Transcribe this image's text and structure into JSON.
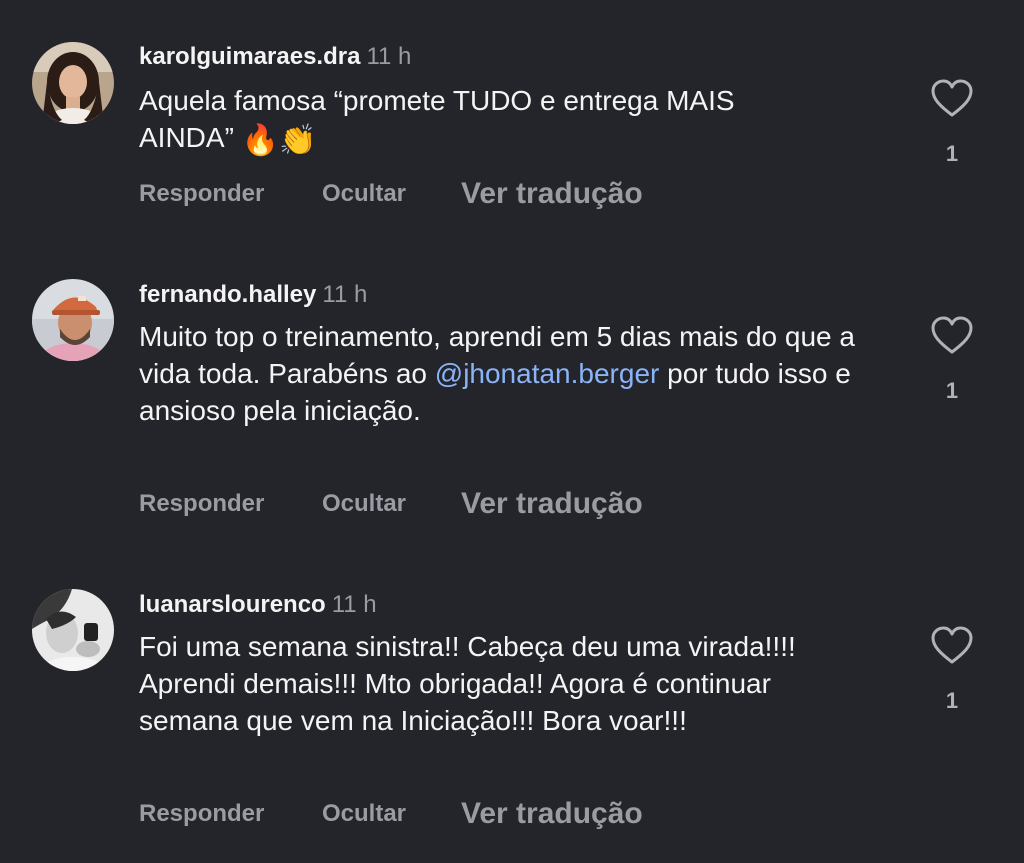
{
  "comments": [
    {
      "username": "karolguimaraes.dra",
      "time": "11 h",
      "text_line1": "Aquela famosa “promete TUDO e entrega MAIS",
      "text_line2": "AINDA”",
      "emojis": "🔥👏",
      "like_count": "1",
      "reply_label": "Responder",
      "hide_label": "Ocultar",
      "translate_label": "Ver tradução",
      "avatar_icon": "profile-photo-woman"
    },
    {
      "username": "fernando.halley",
      "time": "11 h",
      "text_before_mention": "Muito top o treinamento, aprendi em 5 dias mais do que a vida toda. Parabéns ao",
      "mention": "@jhonatan.berger",
      "text_after_mention": "por tudo isso e ansioso pela iniciação.",
      "like_count": "1",
      "reply_label": "Responder",
      "hide_label": "Ocultar",
      "translate_label": "Ver tradução",
      "avatar_icon": "profile-photo-man-cap"
    },
    {
      "username": "luanarslourenco",
      "time": "11 h",
      "text": "Foi uma semana sinistra!! Cabeça deu uma virada!!!! Aprendi demais!!! Mto obrigada!! Agora é continuar semana que vem na Iniciação!!! Bora voar!!!",
      "like_count": "1",
      "reply_label": "Responder",
      "hide_label": "Ocultar",
      "translate_label": "Ver tradução",
      "avatar_icon": "profile-photo-bw"
    }
  ],
  "colors": {
    "background": "#24252a",
    "primary_text": "#f4f4f5",
    "secondary_text": "#9a9ca3",
    "mention": "#8ab4f8"
  },
  "icons": {
    "like": "heart-outline-icon"
  }
}
